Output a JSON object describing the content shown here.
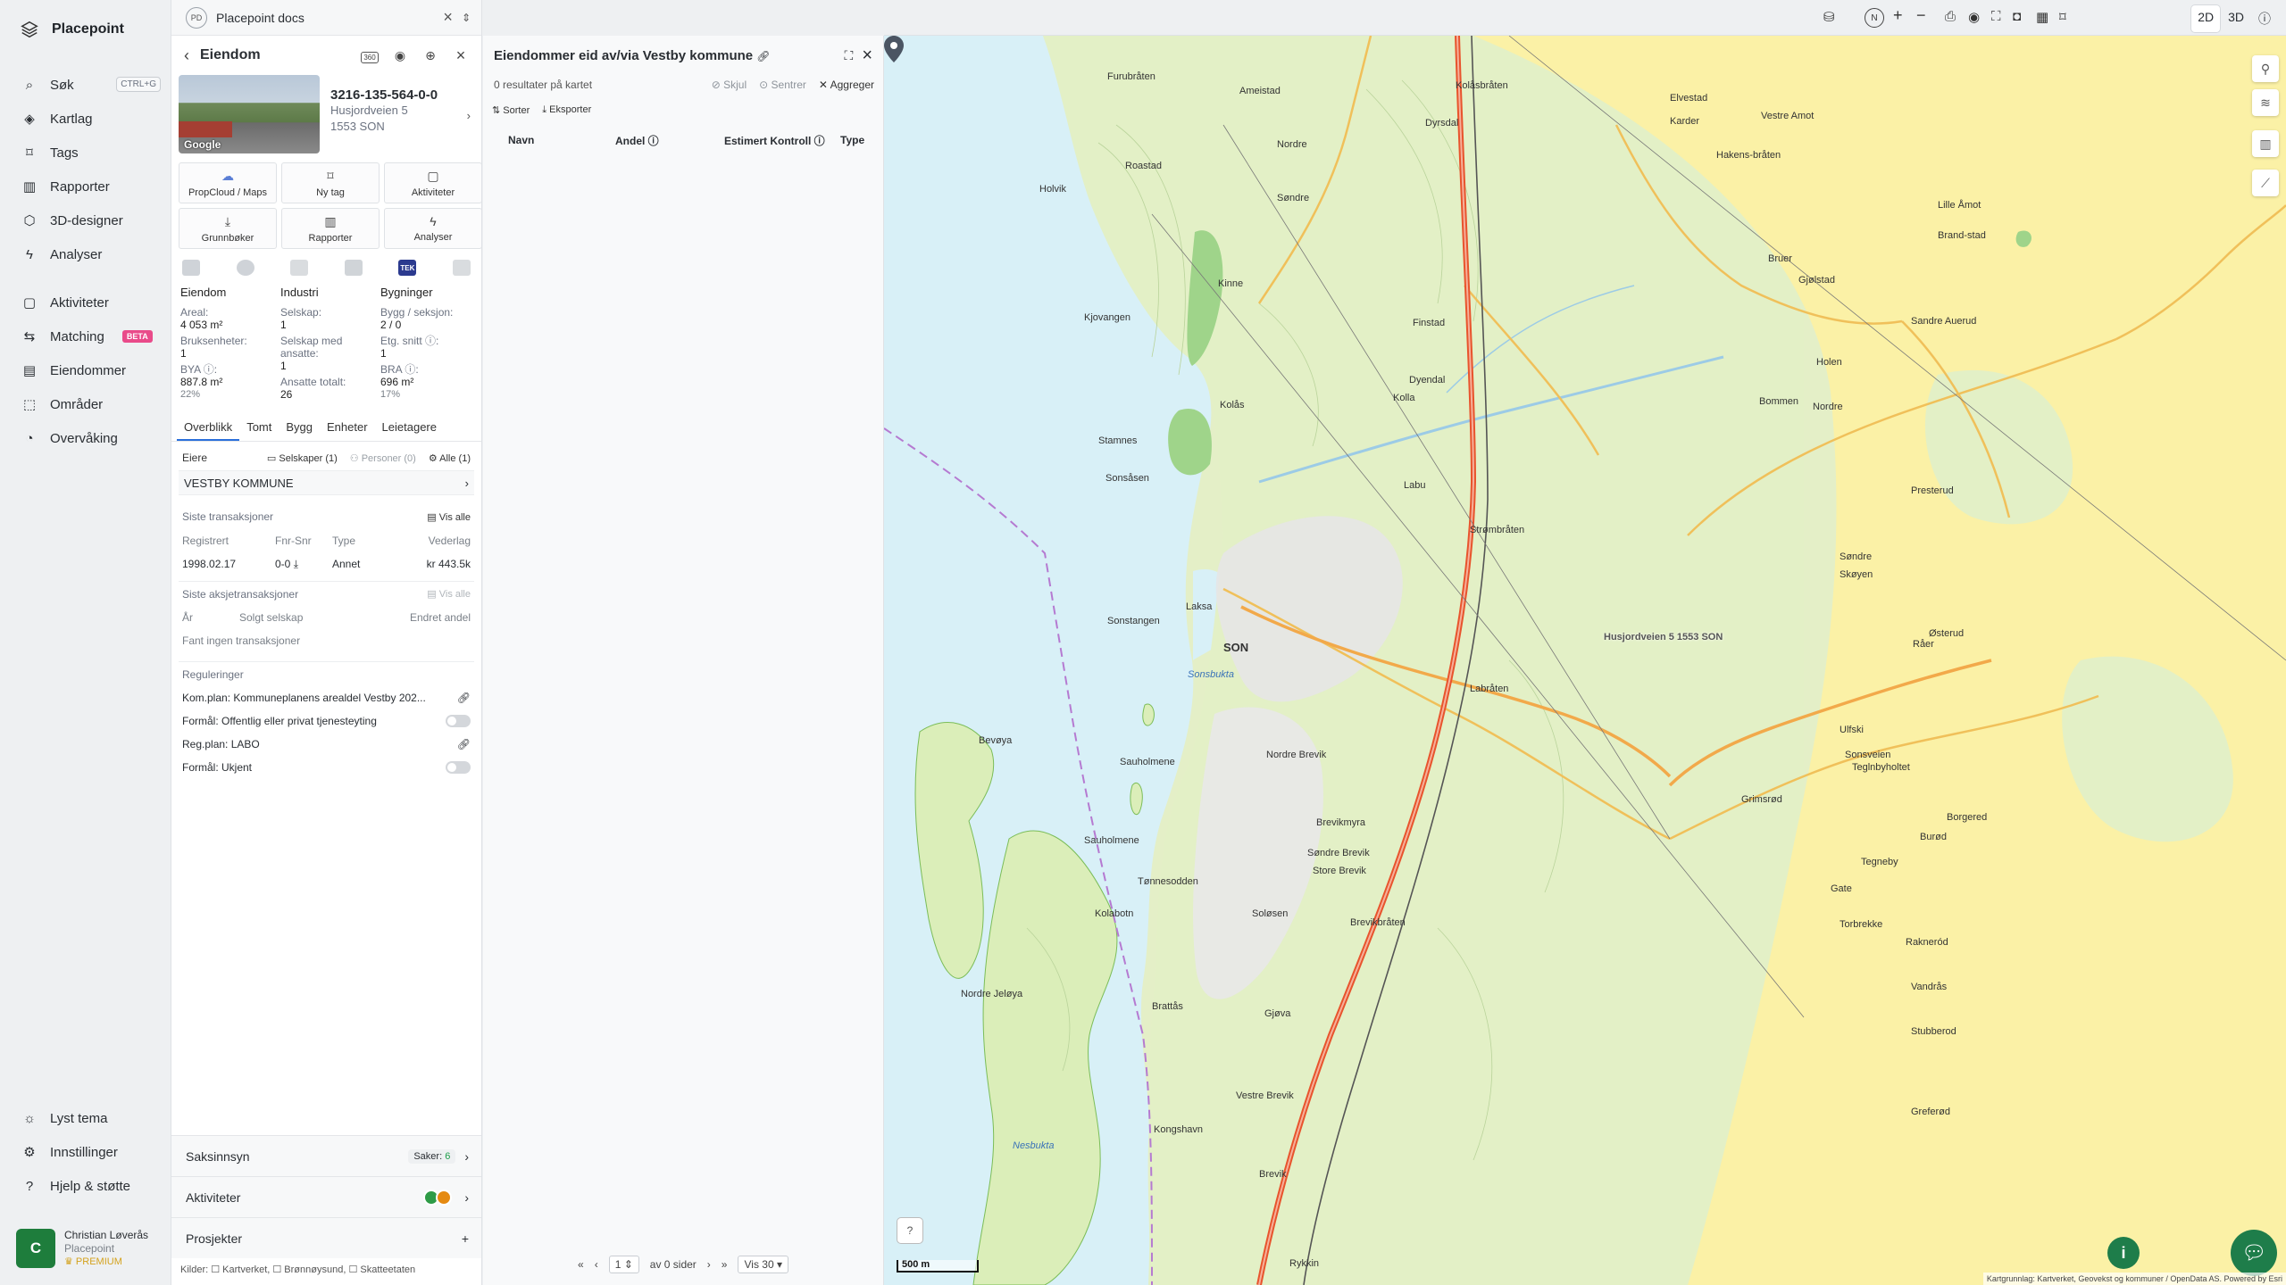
{
  "app": {
    "name": "Placepoint"
  },
  "nav": {
    "items": [
      {
        "label": "Søk",
        "shortcut": "CTRL+G",
        "icon": "search-icon"
      },
      {
        "label": "Kartlag",
        "icon": "layers-icon"
      },
      {
        "label": "Tags",
        "icon": "bookmark-icon"
      },
      {
        "label": "Rapporter",
        "icon": "chart-icon"
      },
      {
        "label": "3D-designer",
        "icon": "cube-icon"
      },
      {
        "label": "Analyser",
        "icon": "bolt-icon"
      }
    ],
    "items2": [
      {
        "label": "Aktiviteter",
        "icon": "chat-icon"
      },
      {
        "label": "Matching",
        "badge": "BETA",
        "icon": "matching-icon"
      },
      {
        "label": "Eiendommer",
        "icon": "buildings-icon"
      },
      {
        "label": "Områder",
        "icon": "area-icon"
      },
      {
        "label": "Overvåking",
        "icon": "monitor-icon"
      }
    ],
    "bottom": [
      {
        "label": "Lyst tema",
        "icon": "sun-icon"
      },
      {
        "label": "Innstillinger",
        "icon": "gear-icon"
      },
      {
        "label": "Hjelp & støtte",
        "icon": "help-icon"
      }
    ],
    "user": {
      "initial": "C",
      "name": "Christian Løverås",
      "org": "Placepoint",
      "plan": "PREMIUM"
    }
  },
  "doc": {
    "badge": "PD",
    "title": "Placepoint docs"
  },
  "property": {
    "header": "Eiendom",
    "badge_360": "360",
    "photo_credit": "Google",
    "id": "3216-135-564-0-0",
    "street": "Husjordveien 5",
    "postal": "1553 SON",
    "tiles": [
      {
        "label": "PropCloud / Maps",
        "icon": "cloud-icon"
      },
      {
        "label": "Ny tag",
        "icon": "bookmark-icon"
      },
      {
        "label": "Aktiviteter",
        "icon": "chat-icon"
      },
      {
        "label": "Grunnbøker",
        "icon": "download-icon"
      },
      {
        "label": "Rapporter",
        "icon": "chart-icon"
      },
      {
        "label": "Analyser",
        "icon": "bolt-icon"
      }
    ],
    "layer_badge": "TEK",
    "facts": {
      "col1_head": "Eiendom",
      "areal_k": "Areal:",
      "areal_v": "4 053 m²",
      "bruks_k": "Bruksenheter:",
      "bruks_v": "1",
      "bya_k": "BYA ⓘ:",
      "bya_v": "887.8 m²",
      "bya_p": "22%",
      "col2_head": "Industri",
      "selskap_k": "Selskap:",
      "selskap_v": "1",
      "ansatte_k": "Selskap med ansatte:",
      "ansatte_v": "1",
      "tot_k": "Ansatte totalt:",
      "tot_v": "26",
      "col3_head": "Bygninger",
      "bygg_k": "Bygg / seksjon:",
      "bygg_v": "2 / 0",
      "etg_k": "Etg. snitt ⓘ:",
      "etg_v": "1",
      "bra_k": "BRA ⓘ:",
      "bra_v": "696 m²",
      "bra_p": "17%"
    },
    "tabs": [
      "Overblikk",
      "Tomt",
      "Bygg",
      "Enheter",
      "Leietagere"
    ],
    "owners": {
      "label": "Eiere",
      "f1": "Selskaper (1)",
      "f2": "Personer (0)",
      "f3": "Alle (1)",
      "name": "VESTBY KOMMUNE"
    },
    "transactions": {
      "title": "Siste transaksjoner",
      "see_all": "Vis alle",
      "cols": [
        "Registrert",
        "Fnr-Snr",
        "Type",
        "Vederlag"
      ],
      "row": [
        "1998.02.17",
        "0-0",
        "Annet",
        "kr 443.5k"
      ]
    },
    "share_tx": {
      "title": "Siste aksjetransaksjoner",
      "see_all": "Vis alle",
      "cols": [
        "År",
        "Solgt selskap",
        "Endret andel"
      ],
      "empty": "Fant ingen transaksjoner"
    },
    "regulations": {
      "title": "Reguleringer",
      "r1": "Kom.plan: Kommuneplanens arealdel Vestby 202...",
      "r2": "Formål: Offentlig eller privat tjenesteyting",
      "r3": "Reg.plan: LABO",
      "r4": "Formål: Ukjent"
    },
    "bottom": {
      "saks": "Saksinnsyn",
      "saks_badge": "Saker:",
      "saks_count": "6",
      "akt": "Aktiviteter",
      "prosj": "Prosjekter"
    },
    "sources": "Kilder: ☐ Kartverket, ☐ Brønnøysund, ☐ Skatteetaten"
  },
  "results": {
    "title": "Eiendommer eid av/via Vestby kommune",
    "count": "0 resultater på kartet",
    "hide": "Skjul",
    "center": "Sentrer",
    "aggregate": "Aggreger",
    "sort": "Sorter",
    "export": "Eksporter",
    "cols": [
      "Navn",
      "Andel ⓘ",
      "Estimert Kontroll ⓘ",
      "Type"
    ],
    "pager": {
      "page": "1",
      "of": "av 0 sider",
      "show": "Vis 30"
    }
  },
  "toolbar": {
    "compass": "N",
    "d2": "2D",
    "d3": "3D"
  },
  "map": {
    "labels": [
      {
        "t": "Furubråten"
      },
      {
        "t": "Ameistad"
      },
      {
        "t": "Kolåsbråten"
      },
      {
        "t": "Elvestad"
      },
      {
        "t": "Vestre Amot"
      },
      {
        "t": "Karder"
      },
      {
        "t": "Dyrsdal"
      },
      {
        "t": "Holvik"
      },
      {
        "t": "Nordre"
      },
      {
        "t": "Roastad"
      },
      {
        "t": "Søndre"
      },
      {
        "t": "Kjovangen"
      },
      {
        "t": "Kinne"
      },
      {
        "t": "Finstad"
      },
      {
        "t": "Kolås"
      },
      {
        "t": "Dyendal"
      },
      {
        "t": "Stamnes"
      },
      {
        "t": "Sonsåsen"
      },
      {
        "t": "Kolla"
      },
      {
        "t": "Labu"
      },
      {
        "t": "Strømbråten"
      },
      {
        "t": "Laksa"
      },
      {
        "t": "Sonstangen"
      },
      {
        "t": "SON"
      },
      {
        "t": "Sonsbukta",
        "w": 1
      },
      {
        "t": "Labråten"
      },
      {
        "t": "Bevøya"
      },
      {
        "t": "Sauholmene"
      },
      {
        "t": "Nordre Brevik"
      },
      {
        "t": "Brevikmyra"
      },
      {
        "t": "Søndre Brevik"
      },
      {
        "t": "Sauholmene"
      },
      {
        "t": "Tønnesodden"
      },
      {
        "t": "Store Brevik"
      },
      {
        "t": "Kolabotn"
      },
      {
        "t": "Soløsen"
      },
      {
        "t": "Brevikbråten"
      },
      {
        "t": "Nordre Jeløya"
      },
      {
        "t": "Brattås"
      },
      {
        "t": "Gjøva"
      },
      {
        "t": "Vestre Brevik"
      },
      {
        "t": "Kongshavn"
      },
      {
        "t": "Nesbukta",
        "w": 1
      },
      {
        "t": "Brevik"
      },
      {
        "t": "Rykkin"
      },
      {
        "t": "Holen"
      },
      {
        "t": "Bommen"
      },
      {
        "t": "Nordre"
      },
      {
        "t": "Presterud"
      },
      {
        "t": "Søndre"
      },
      {
        "t": "Skøyen"
      },
      {
        "t": "Råer"
      },
      {
        "t": "Østerud"
      },
      {
        "t": "Sonsveien"
      },
      {
        "t": "Grimsrød"
      },
      {
        "t": "Ulfski"
      },
      {
        "t": "Teglnbyholtet"
      },
      {
        "t": "Tegneby"
      },
      {
        "t": "Gate"
      },
      {
        "t": "Torbrekke"
      },
      {
        "t": "Rakneród"
      },
      {
        "t": "Vandrås"
      },
      {
        "t": "Stubberod"
      },
      {
        "t": "Greferød"
      },
      {
        "t": "Borgered"
      },
      {
        "t": "Burød"
      },
      {
        "t": "Lille Åmot"
      },
      {
        "t": "Brand-stad"
      },
      {
        "t": "Sandre Auerud"
      },
      {
        "t": "Hakens-bråten"
      },
      {
        "t": "Bruer"
      },
      {
        "t": "Gjølstad"
      }
    ],
    "address_label": "Husjordveien 5 1553 SON",
    "scale": "500 m",
    "attribution": "Kartgrunnlag: Kartverket, Geovekst og kommuner / OpenData AS. Powered by Esri"
  }
}
